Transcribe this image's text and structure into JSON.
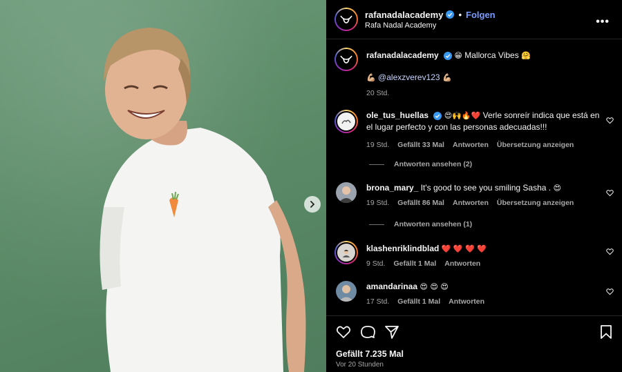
{
  "post": {
    "username": "rafanadalacademy",
    "follow_label": "Folgen",
    "subtitle": "Rafa Nadal Academy",
    "more_label": "•••"
  },
  "caption": {
    "username": "rafanadalacademy",
    "emoji_before": "😁",
    "text": "Mallorca Vibes",
    "emoji_after": "🤗",
    "flex_before": "💪🏼",
    "mention": "@alexzverev123",
    "flex_after": "💪🏼",
    "time": "20 Std."
  },
  "comments": [
    {
      "username": "ole_tus_huellas",
      "verified": true,
      "emojis": "😍🙌🔥❤️",
      "text": "Verle sonreír indica que está en el lugar perfecto y con las personas adecuadas!!!",
      "time": "19 Std.",
      "likes": "Gefällt 33 Mal",
      "reply": "Antworten",
      "translate": "Übersetzung anzeigen",
      "view_replies": "Antworten ansehen (2)"
    },
    {
      "username": "brona_mary_",
      "text": "It's good to see you smiling Sasha .",
      "emoji_after": "😍",
      "time": "19 Std.",
      "likes": "Gefällt 86 Mal",
      "reply": "Antworten",
      "translate": "Übersetzung anzeigen",
      "view_replies": "Antworten ansehen (1)"
    },
    {
      "username": "klashenriklindblad",
      "emojis": "❤️ ❤️ ❤️ ❤️",
      "time": "9 Std.",
      "likes": "Gefällt 1 Mal",
      "reply": "Antworten"
    },
    {
      "username": "amandarinaa",
      "emojis": "😍 😍 😍",
      "time": "17 Std.",
      "likes": "Gefällt 1 Mal",
      "reply": "Antworten"
    }
  ],
  "footer": {
    "likes": "Gefällt 7.235 Mal",
    "time": "Vor 20 Stunden"
  },
  "colors": {
    "background": "#000000",
    "accent_blue": "#7a9cff",
    "mention": "#c7d5ff",
    "muted": "#a8a8a8",
    "divider": "#262626"
  },
  "icons": [
    "bull-logo-icon",
    "verified-icon",
    "heart-icon",
    "comment-icon",
    "share-icon",
    "bookmark-icon",
    "chevron-right-icon",
    "more-icon"
  ]
}
